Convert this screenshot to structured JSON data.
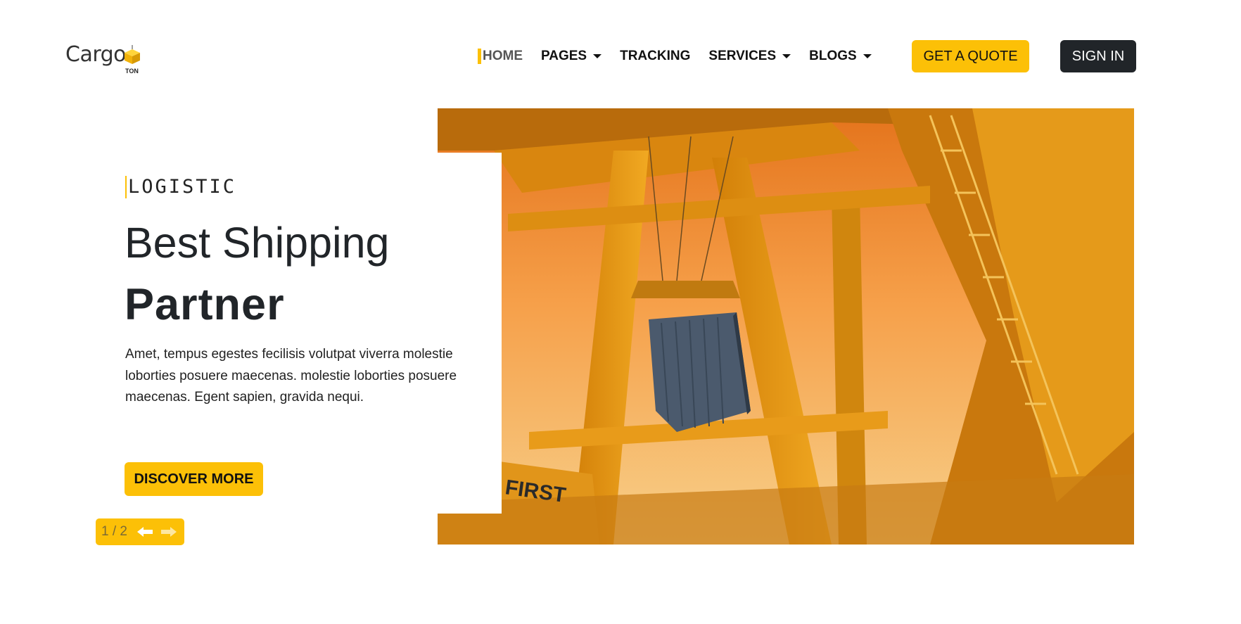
{
  "brand": {
    "name": "Cargo",
    "sub": "TON",
    "accent_color": "#fcc007",
    "dark_color": "#212529"
  },
  "nav": {
    "items": [
      {
        "label": "HOME",
        "active": true,
        "dropdown": false
      },
      {
        "label": "PAGES",
        "active": false,
        "dropdown": true
      },
      {
        "label": "TRACKING",
        "active": false,
        "dropdown": false
      },
      {
        "label": "SERVICES",
        "active": false,
        "dropdown": true
      },
      {
        "label": "BLOGS",
        "active": false,
        "dropdown": true
      }
    ],
    "quote_label": "GET A QUOTE",
    "signin_label": "SIGN IN"
  },
  "hero": {
    "eyebrow": "LOGISTIC",
    "headline_light": "Best Shipping",
    "headline_bold": "Partner",
    "description": "Amet, tempus egestes fecilisis volutpat viverra molestie loborties posuere maecenas. molestie loborties posuere maecenas. Egent sapien, gravida nequi.",
    "cta_label": "DISCOVER MORE",
    "image_caption": "FIRST",
    "image_alt": "Port crane lifting a shipping container at sunset"
  },
  "slider": {
    "current": 1,
    "total": 2,
    "counter_text": "1 / 2",
    "prev_icon": "arrow-left-icon",
    "next_icon": "arrow-right-icon"
  }
}
